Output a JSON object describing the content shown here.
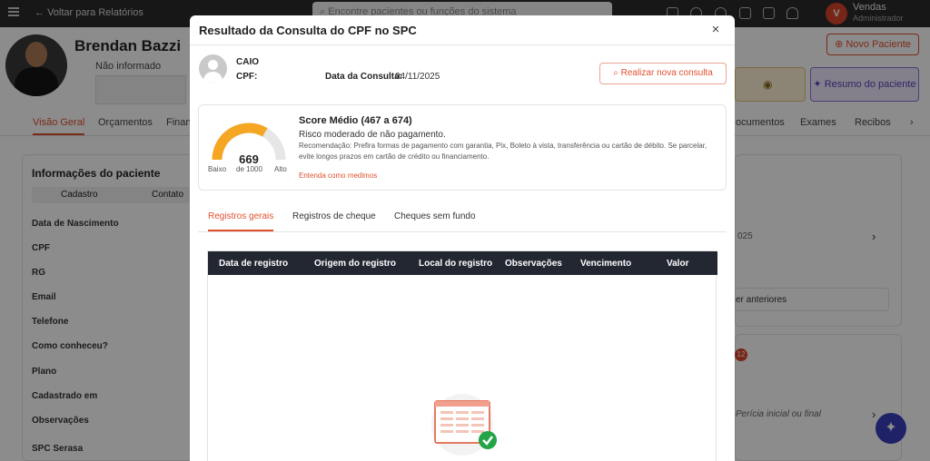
{
  "topbar": {
    "back_label": "Voltar para Relatórios",
    "search_placeholder": "Encontre pacientes ou funções do sistema",
    "avatar_initial": "V",
    "user_name": "Vendas",
    "user_role": "Administrador"
  },
  "patient": {
    "name": "Brendan Bazzi",
    "phone": "Não informado",
    "tabs": [
      "Visão Geral",
      "Orçamentos",
      "Finan"
    ],
    "right_tabs": [
      "ocumentos",
      "Exames",
      "Recibos"
    ],
    "new_patient_label": "Novo Paciente",
    "summary_label": "Resumo do paciente",
    "info_title": "Informações do paciente",
    "info_segments": [
      "Cadastro",
      "Contato"
    ],
    "fields": [
      "Data de Nascimento",
      "CPF",
      "RG",
      "Email",
      "Telefone",
      "Como conheceu?",
      "Plano",
      "Cadastrado em",
      "Observações",
      "SPC Serasa"
    ],
    "right_snippets": {
      "year": "025",
      "previous": "er anteriores",
      "badge": "12",
      "pericia": "Perícia inicial ou final"
    }
  },
  "modal": {
    "title": "Resultado da Consulta do CPF no SPC",
    "close_label": "×",
    "person_name": "CAIO",
    "cpf_label": "CPF:",
    "cpf_value": "",
    "date_label": "Data da Consulta:",
    "date_value": "04/11/2025",
    "new_query_label": "Realizar nova consulta",
    "score": {
      "value": "669",
      "value_num": 669,
      "max": 1000,
      "of_label": "de 1000",
      "low_label": "Baixo",
      "high_label": "Alto",
      "title": "Score Médio (467 a 674)",
      "risk": "Risco moderado de não pagamento.",
      "recommendation": "Recomendação: Prefira formas de pagamento com garantia, Pix, Boleto à vista, transferência ou cartão de débito. Se parcelar, evite longos prazos em cartão de crédito ou financiamento.",
      "link": "Entenda como medimos",
      "gauge_color": "#f5a623"
    },
    "tabs": [
      {
        "label": "Registros gerais",
        "active": true
      },
      {
        "label": "Registros de cheque",
        "active": false
      },
      {
        "label": "Cheques sem fundo",
        "active": false
      }
    ],
    "table": {
      "columns": [
        "Data de registro",
        "Origem do registro",
        "Local do registro",
        "Observações",
        "Vencimento",
        "Valor"
      ],
      "rows": []
    }
  },
  "colors": {
    "accent": "#e0502f",
    "table_header": "#232732",
    "success": "#22a447"
  }
}
